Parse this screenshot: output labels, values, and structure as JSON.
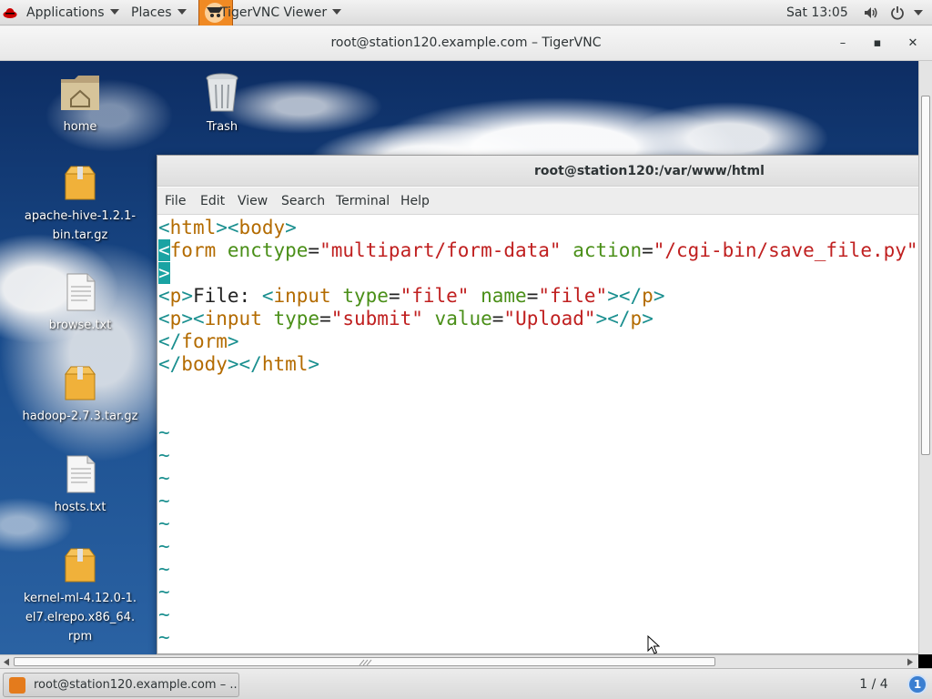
{
  "top_panel": {
    "applications_label": "Applications",
    "places_label": "Places",
    "active_app_label": "TigerVNC Viewer",
    "clock": "Sat 13:05",
    "icons": [
      "redhat-icon",
      "volume-icon",
      "power-icon"
    ]
  },
  "vnc_window": {
    "title": "root@station120.example.com – TigerVNC",
    "minimize_glyph": "–",
    "maximize_glyph": "▪",
    "close_glyph": "✕"
  },
  "desktop": {
    "icons": [
      {
        "label": "home",
        "icon": "home-folder-icon"
      },
      {
        "label": "Trash",
        "icon": "trash-icon"
      },
      {
        "label": "apache-hive-1.2.1-bin.tar.gz",
        "icon": "archive-icon"
      },
      {
        "label": "browse.txt",
        "icon": "text-file-icon"
      },
      {
        "label": "hadoop-2.7.3.tar.gz",
        "icon": "archive-icon"
      },
      {
        "label": "hosts.txt",
        "icon": "text-file-icon"
      },
      {
        "label": "kernel-ml-4.12.0-1.el7.elrepo.x86_64.rpm",
        "icon": "archive-icon"
      }
    ],
    "label_lines": {
      "hive": [
        "apache-hive-1.2.1-",
        "bin.tar.gz"
      ],
      "kernel": [
        "kernel-ml-4.12.0-1.",
        "el7.elrepo.x86_64.",
        "rpm"
      ]
    }
  },
  "terminal": {
    "title": "root@station120:/var/www/html",
    "menu": [
      "File",
      "Edit",
      "View",
      "Search",
      "Terminal",
      "Help"
    ],
    "code_lines": [
      "<html><body>",
      "<form enctype=\"multipart/form-data\" action=\"/cgi-bin/save_file.py\"",
      ">",
      "<p>File: <input type=\"file\" name=\"file\"></p>",
      "<p><input type=\"submit\" value=\"Upload\"></p>",
      "</form>",
      "</body></html>"
    ],
    "empty_line_marker": "~",
    "empty_line_count": 10
  },
  "taskbar": {
    "task_label": "root@station120.example.com – ...",
    "workspace": "1 / 4",
    "notification_count": "1"
  },
  "colors": {
    "vim_tag": "#1a8f8f",
    "vim_attr": "#4a8f18",
    "vim_string": "#c02020",
    "vim_element": "#b36b00",
    "cursor": "#1aa3a3"
  }
}
